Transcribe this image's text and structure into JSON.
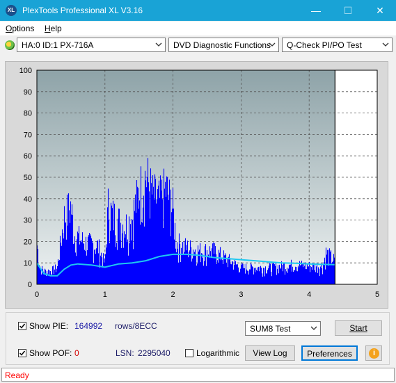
{
  "window": {
    "title": "PlexTools Professional XL V3.16",
    "app_icon_text": "XL",
    "minimize_glyph": "—",
    "maximize_glyph": "☐",
    "close_glyph": "✕"
  },
  "menu": [
    {
      "mnemonic": "O",
      "rest": "ptions"
    },
    {
      "mnemonic": "H",
      "rest": "elp"
    }
  ],
  "toolbar": {
    "drive": "HA:0 ID:1  PX-716A",
    "function": "DVD Diagnostic Functions",
    "test": "Q-Check PI/PO Test"
  },
  "chart_data": {
    "type": "bar",
    "xlabel": "",
    "ylabel": "",
    "xlim": [
      0,
      5
    ],
    "ylim": [
      0,
      100
    ],
    "x_ticks": [
      "0",
      "1",
      "2",
      "3",
      "4",
      "5"
    ],
    "y_ticks": [
      "0",
      "10",
      "20",
      "30",
      "40",
      "50",
      "60",
      "70",
      "80",
      "90",
      "100"
    ],
    "grid": true,
    "disc_end": 4.38,
    "colors": {
      "bars": "#0000ff",
      "line": "#1ec8f0",
      "bg_top": "#8ea3a8",
      "bg_bottom": "#eef2f2"
    },
    "series": [
      {
        "kind": "bars",
        "envelope": [
          [
            0.0,
            25
          ],
          [
            0.05,
            10
          ],
          [
            0.1,
            8
          ],
          [
            0.2,
            8
          ],
          [
            0.3,
            10
          ],
          [
            0.4,
            40
          ],
          [
            0.5,
            47
          ],
          [
            0.55,
            30
          ],
          [
            0.7,
            25
          ],
          [
            0.9,
            23
          ],
          [
            1.0,
            12
          ],
          [
            1.05,
            48
          ],
          [
            1.1,
            42
          ],
          [
            1.2,
            38
          ],
          [
            1.3,
            35
          ],
          [
            1.4,
            40
          ],
          [
            1.5,
            55
          ],
          [
            1.6,
            65
          ],
          [
            1.7,
            53
          ],
          [
            1.8,
            50
          ],
          [
            1.9,
            57
          ],
          [
            2.0,
            45
          ],
          [
            2.05,
            25
          ],
          [
            2.2,
            22
          ],
          [
            2.4,
            20
          ],
          [
            2.6,
            20
          ],
          [
            2.8,
            15
          ],
          [
            3.0,
            10
          ],
          [
            3.2,
            10
          ],
          [
            3.4,
            10
          ],
          [
            3.6,
            11
          ],
          [
            3.8,
            12
          ],
          [
            4.0,
            11
          ],
          [
            4.2,
            11
          ],
          [
            4.25,
            19
          ],
          [
            4.3,
            17
          ],
          [
            4.38,
            14
          ]
        ]
      },
      {
        "kind": "line",
        "points": [
          [
            0.0,
            10
          ],
          [
            0.1,
            5
          ],
          [
            0.2,
            4
          ],
          [
            0.3,
            4
          ],
          [
            0.4,
            7
          ],
          [
            0.5,
            9
          ],
          [
            0.6,
            9.5
          ],
          [
            0.8,
            9
          ],
          [
            1.0,
            8
          ],
          [
            1.2,
            9.5
          ],
          [
            1.4,
            10
          ],
          [
            1.6,
            11
          ],
          [
            1.8,
            13
          ],
          [
            2.0,
            14
          ],
          [
            2.2,
            14
          ],
          [
            2.4,
            13.5
          ],
          [
            2.6,
            12.5
          ],
          [
            2.8,
            12
          ],
          [
            3.0,
            11.5
          ],
          [
            3.2,
            11
          ],
          [
            3.4,
            10.5
          ],
          [
            3.6,
            10
          ],
          [
            3.8,
            9.8
          ],
          [
            4.0,
            9.5
          ],
          [
            4.2,
            9.3
          ],
          [
            4.38,
            9.2
          ]
        ]
      }
    ]
  },
  "controls": {
    "show_pie_label": "Show PIE:",
    "show_pie_checked": true,
    "pie_value": "164992",
    "rows_label": "rows/8ECC",
    "show_pof_label": "Show POF:",
    "show_pof_checked": true,
    "pof_value": "0",
    "lsn_label": "LSN:",
    "lsn_value": "2295040",
    "log_label": "Logarithmic",
    "log_checked": false,
    "sum_select": "SUM8 Test",
    "start_button": "Start",
    "view_log_button": "View Log",
    "preferences_button": "Preferences",
    "info_icon": "i"
  },
  "status": {
    "text": "Ready",
    "color": "#ff0000"
  }
}
